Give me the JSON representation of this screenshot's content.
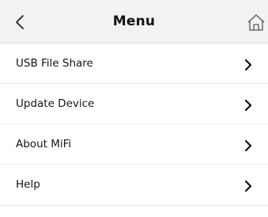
{
  "header": {
    "title": "Menu",
    "back_icon": "chevron-left-icon",
    "home_icon": "home-icon"
  },
  "menu": {
    "items": [
      {
        "label": "USB File Share",
        "icon": "chevron-right-icon"
      },
      {
        "label": "Update Device",
        "icon": "chevron-right-icon"
      },
      {
        "label": "About MiFi",
        "icon": "chevron-right-icon"
      },
      {
        "label": "Help",
        "icon": "chevron-right-icon"
      }
    ]
  },
  "colors": {
    "header_bg": "#f2f2f2",
    "divider": "#ececec",
    "text": "#111111",
    "background": "#ffffff"
  }
}
